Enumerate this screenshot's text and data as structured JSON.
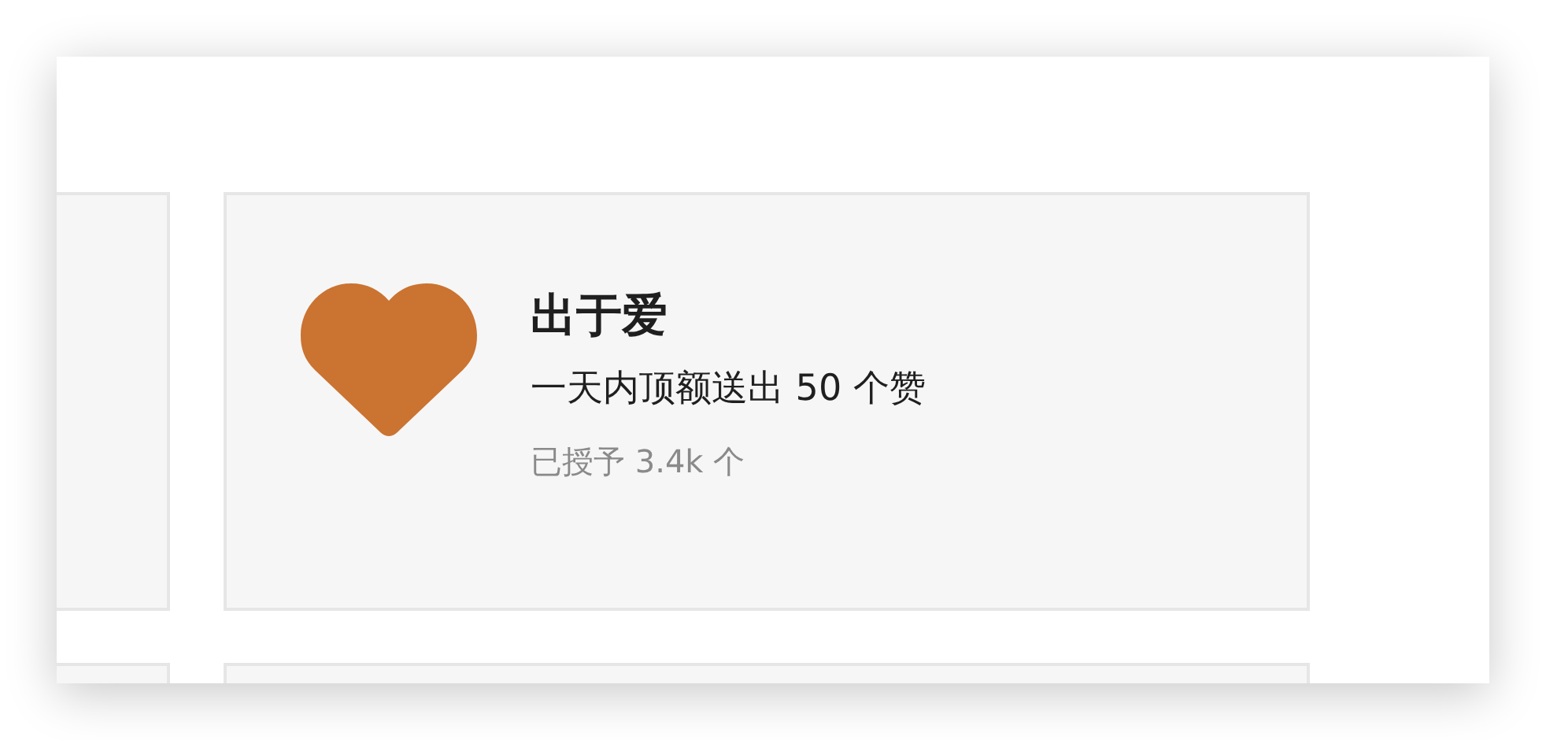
{
  "card_rows": [
    [
      {
        "kind": "blank"
      },
      {
        "kind": "badge",
        "title": "出于爱",
        "description": "一天内顶额送出 50 个赞",
        "stat": "已授予 3.4k 个"
      }
    ],
    [
      {
        "kind": "blank"
      },
      {
        "kind": "blank"
      }
    ]
  ]
}
